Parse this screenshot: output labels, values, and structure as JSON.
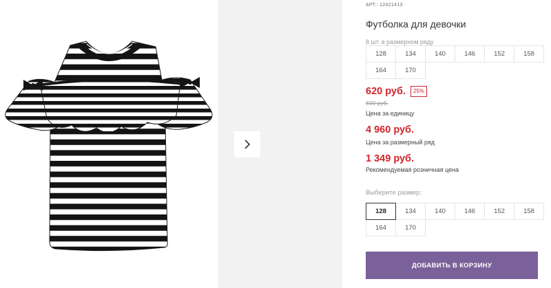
{
  "product": {
    "art_label": "АРТ.:",
    "art_number": "12421413",
    "title": "Футболка для девочки",
    "pack_note": "8 шт. в размерном ряду"
  },
  "pack_sizes": [
    "128",
    "134",
    "140",
    "146",
    "152",
    "158",
    "164",
    "170"
  ],
  "pricing": {
    "price": "620 руб.",
    "discount": "25%",
    "old_price": "830 руб.",
    "unit_label": "Цена за единицу",
    "pack_price": "4 960 руб.",
    "pack_label": "Цена за размерный ряд",
    "rrp_price": "1 349 руб.",
    "rrp_label": "Рекомендуемая розничная цена"
  },
  "size_picker": {
    "label": "Выберите размер:",
    "options": [
      "128",
      "134",
      "140",
      "146",
      "152",
      "158",
      "164",
      "170"
    ],
    "selected": "128"
  },
  "cart_button": "ДОБАВИТЬ В КОРЗИНУ",
  "colors": {
    "accent": "#7b6199",
    "price": "#d0262e"
  },
  "icons": {
    "next": "chevron-right-icon"
  }
}
